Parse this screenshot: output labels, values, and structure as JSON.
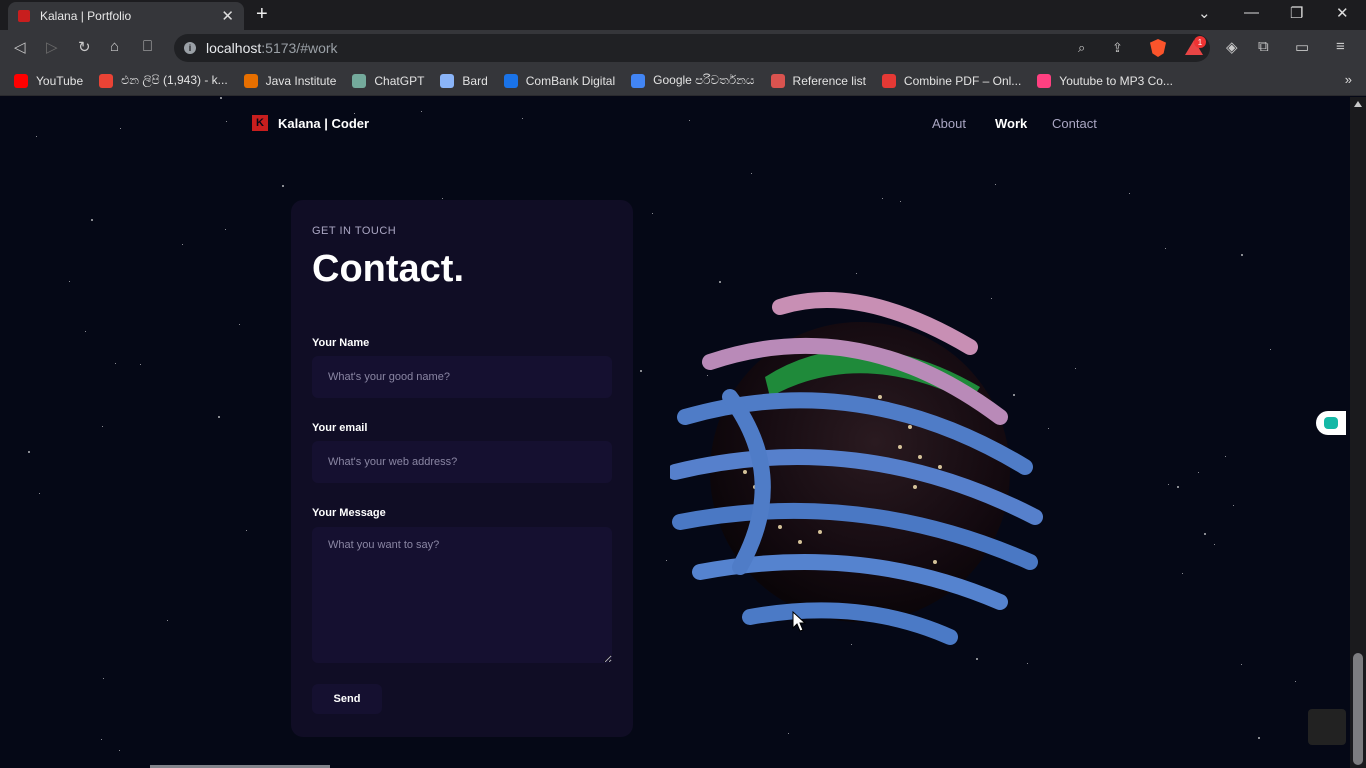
{
  "browser": {
    "tab_title": "Kalana | Portfolio",
    "tab_close": "✕",
    "new_tab": "+",
    "url_host": "localhost",
    "url_rest": ":5173/#work",
    "bookmarks": [
      {
        "label": "YouTube",
        "icon": "youtube-icon",
        "color": "#ff0000"
      },
      {
        "label": "එන ලිපි (1,943) - k...",
        "icon": "gmail-icon",
        "color": "#ea4335"
      },
      {
        "label": "Java Institute",
        "icon": "java-icon",
        "color": "#e76f00"
      },
      {
        "label": "ChatGPT",
        "icon": "chatgpt-icon",
        "color": "#74aa9c"
      },
      {
        "label": "Bard",
        "icon": "bard-icon",
        "color": "#8ab4f8"
      },
      {
        "label": "ComBank Digital",
        "icon": "combank-icon",
        "color": "#1a73e8"
      },
      {
        "label": "Google පරිවර්තනය",
        "icon": "translate-icon",
        "color": "#4285f4"
      },
      {
        "label": "Reference list",
        "icon": "reference-icon",
        "color": "#d9534f"
      },
      {
        "label": "Combine PDF – Onl...",
        "icon": "pdf-icon",
        "color": "#e53935"
      },
      {
        "label": "Youtube to MP3 Co...",
        "icon": "mp3-icon",
        "color": "#ff4081"
      }
    ],
    "bookmarks_more": "»",
    "reward_count": "1"
  },
  "site": {
    "logo_letter": "K",
    "logo_text": "Kalana | Coder",
    "nav": [
      {
        "label": "About",
        "active": false
      },
      {
        "label": "Work",
        "active": true
      },
      {
        "label": "Contact",
        "active": false
      }
    ]
  },
  "contact": {
    "subtitle": "GET IN TOUCH",
    "heading": "Contact.",
    "name_label": "Your Name",
    "name_placeholder": "What's your good name?",
    "email_label": "Your email",
    "email_placeholder": "What's your web address?",
    "message_label": "Your Message",
    "message_placeholder": "What you want to say?",
    "send_label": "Send"
  },
  "colors": {
    "background": "#050816",
    "card": "#100d25",
    "input": "#151030",
    "secondary_text": "#aaa6c3",
    "brand": "#c81e1e"
  }
}
